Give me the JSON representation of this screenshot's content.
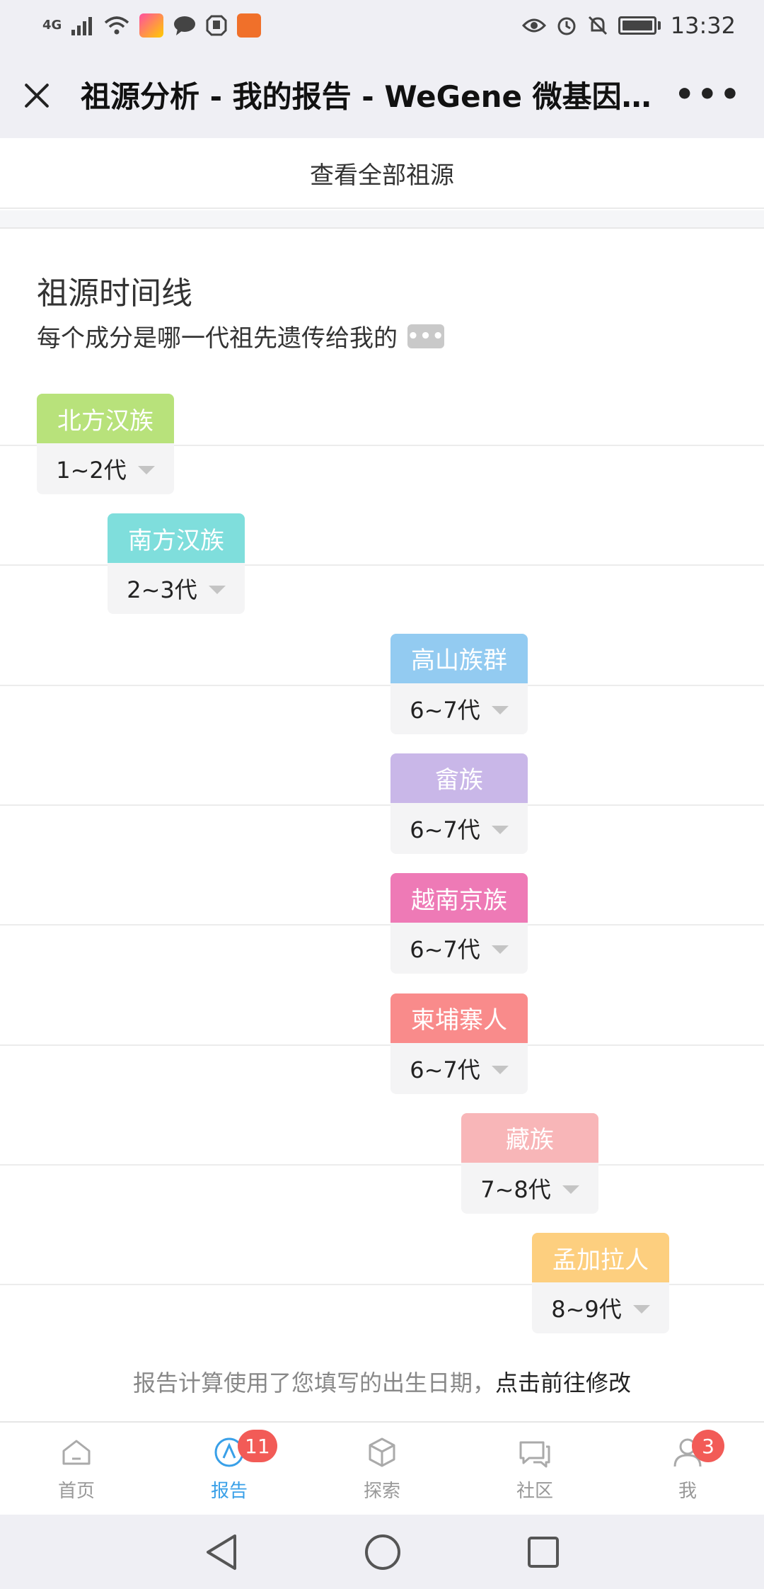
{
  "status": {
    "network": "4G",
    "time": "13:32"
  },
  "header": {
    "title": "祖源分析 - 我的报告 - WeGene 微基因 - 专...",
    "more": "•••"
  },
  "view_all_label": "查看全部祖源",
  "timeline": {
    "title": "祖源时间线",
    "subtitle": "每个成分是哪一代祖先遗传给我的",
    "info_badge": "•••",
    "items": [
      {
        "name": "北方汉族",
        "generation": "1~2代",
        "color": "#b8e27b"
      },
      {
        "name": "南方汉族",
        "generation": "2~3代",
        "color": "#7fdedc"
      },
      {
        "name": "高山族群",
        "generation": "6~7代",
        "color": "#93cbf1"
      },
      {
        "name": "畲族",
        "generation": "6~7代",
        "color": "#c9b7e8"
      },
      {
        "name": "越南京族",
        "generation": "6~7代",
        "color": "#ee7ab6"
      },
      {
        "name": "柬埔寨人",
        "generation": "6~7代",
        "color": "#f98b8b"
      },
      {
        "name": "藏族",
        "generation": "7~8代",
        "color": "#f8b6b8"
      },
      {
        "name": "孟加拉人",
        "generation": "8~9代",
        "color": "#fdcf7f"
      }
    ]
  },
  "note": {
    "text": "报告计算使用了您填写的出生日期，",
    "link": "点击前往修改"
  },
  "tabs": [
    {
      "label": "首页",
      "icon": "home-icon",
      "badge": ""
    },
    {
      "label": "报告",
      "icon": "report-icon",
      "badge": "11"
    },
    {
      "label": "探索",
      "icon": "cube-icon",
      "badge": ""
    },
    {
      "label": "社区",
      "icon": "chat-icon",
      "badge": ""
    },
    {
      "label": "我",
      "icon": "user-icon",
      "badge": "3"
    }
  ]
}
